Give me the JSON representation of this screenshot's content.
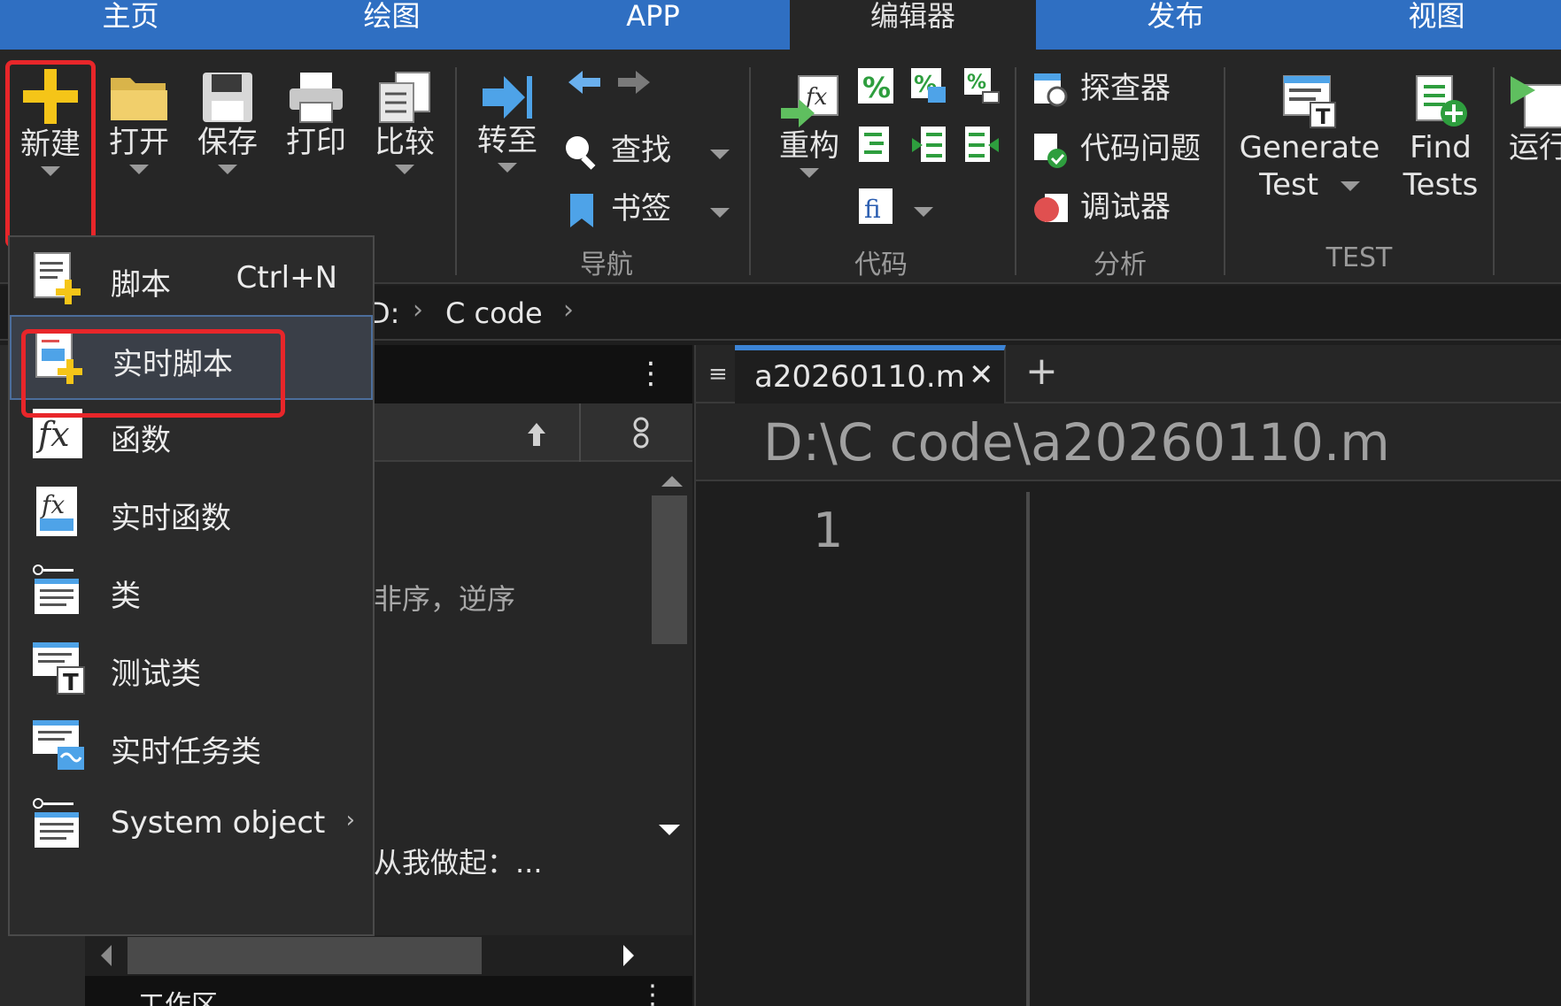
{
  "tabs": [
    "主页",
    "绘图",
    "APP",
    "编辑器",
    "发布",
    "视图"
  ],
  "ribbon": {
    "new": "新建",
    "open": "打开",
    "save": "保存",
    "print": "打印",
    "compare": "比较",
    "goto": "转至",
    "find": "查找",
    "bookmark": "书签",
    "nav_group": "导航",
    "refactor": "重构",
    "code_group": "代码",
    "explorer": "探查器",
    "code_issues": "代码问题",
    "debugger": "调试器",
    "analysis_group": "分析",
    "generate_test_1": "Generate",
    "generate_test_2": "Test",
    "find_tests_1": "Find",
    "find_tests_2": "Tests",
    "test_group": "TEST",
    "run": "运行"
  },
  "address": {
    "drive": "D:",
    "folder": "C code"
  },
  "file_browser": {
    "row1_text": "非序，逆序",
    "row2_text": "从我做起：...",
    "workspace_label": "工作区"
  },
  "editor": {
    "tab_name": "a20260110.m",
    "path": "D:\\C code\\a20260110.m",
    "line_number": "1"
  },
  "menu": {
    "items": [
      {
        "label": "脚本",
        "shortcut": "Ctrl+N"
      },
      {
        "label": "实时脚本"
      },
      {
        "label": "函数"
      },
      {
        "label": "实时函数"
      },
      {
        "label": "类"
      },
      {
        "label": "测试类"
      },
      {
        "label": "实时任务类"
      },
      {
        "label": "System object"
      }
    ]
  },
  "colors": {
    "accent": "#2f6fc2",
    "highlight": "#e8262a",
    "ribbon_bg": "#262626"
  }
}
